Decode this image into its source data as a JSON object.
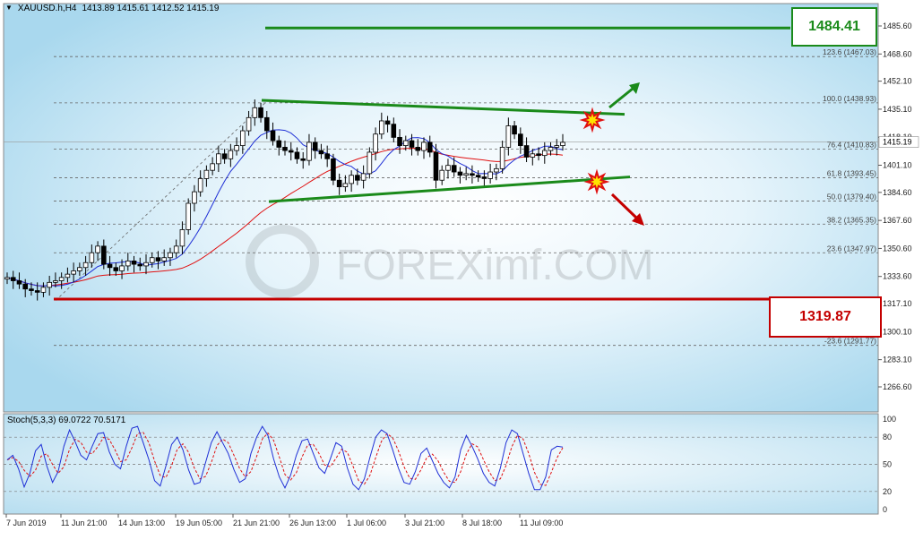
{
  "header": {
    "symbol": "XAUUSD.h,H4",
    "ohlc": "1413.89 1415.61 1412.52 1415.19"
  },
  "watermark": "FOREXimf.COM",
  "resistance_label": "1484.41",
  "support_label": "1319.87",
  "stoch_header": "Stoch(5,3,3) 69.0722 70.5171",
  "colors": {
    "resistance": "#1a8a1a",
    "support": "#c40000",
    "candle_up": "#000000",
    "ma_fast": "#1f2fd6",
    "ma_slow": "#e01010",
    "stoch_main": "#1f2fd6",
    "stoch_signal": "#e01010"
  },
  "chart_data": {
    "type": "candlestick",
    "instrument": "XAUUSD.h",
    "timeframe": "H4",
    "last_price": 1415.19,
    "price_ticks": [
      "1485.60",
      "1468.60",
      "1452.10",
      "1435.10",
      "1418.10",
      "1401.10",
      "1384.60",
      "1367.60",
      "1350.60",
      "1333.60",
      "1317.10",
      "1300.10",
      "1283.10",
      "1266.60"
    ],
    "price_tick_values": [
      1485.6,
      1468.6,
      1452.1,
      1435.1,
      1418.1,
      1401.1,
      1384.6,
      1367.6,
      1350.6,
      1333.6,
      1317.1,
      1300.1,
      1283.1,
      1266.6
    ],
    "time_ticks": [
      "7 Jun 2019",
      "11 Jun 21:00",
      "14 Jun 13:00",
      "19 Jun 05:00",
      "21 Jun 21:00",
      "26 Jun 13:00",
      "1 Jul 06:00",
      "3 Jul 21:00",
      "8 Jul 18:00",
      "11 Jul 09:00"
    ],
    "fib_levels": [
      {
        "label": "123.6 (1467.03)",
        "value": 1467.03
      },
      {
        "label": "100.0 (1438.93)",
        "value": 1438.93
      },
      {
        "label": "76.4 (1410.83)",
        "value": 1410.83
      },
      {
        "label": "61.8 (1393.45)",
        "value": 1393.45
      },
      {
        "label": "50.0 (1379.40)",
        "value": 1379.4
      },
      {
        "label": "38.2 (1365.35)",
        "value": 1365.35
      },
      {
        "label": "23.6 (1347.97)",
        "value": 1347.97
      },
      {
        "label": "-23.6 (1291.77)",
        "value": 1291.77
      }
    ],
    "resistance": 1484.41,
    "support": 1319.87,
    "triangle_upper": {
      "start_price": 1440.5,
      "end_price": 1432.0
    },
    "triangle_lower": {
      "start_price": 1379.0,
      "end_price": 1394.0
    },
    "closes": [
      1333,
      1331,
      1329,
      1326,
      1325,
      1324,
      1327,
      1330,
      1331,
      1333,
      1335,
      1337,
      1339,
      1342,
      1348,
      1352,
      1341,
      1339,
      1337,
      1340,
      1343,
      1341,
      1340,
      1342,
      1345,
      1343,
      1345,
      1348,
      1352,
      1362,
      1378,
      1385,
      1393,
      1398,
      1402,
      1408,
      1405,
      1410,
      1413,
      1422,
      1430,
      1436,
      1430,
      1422,
      1416,
      1412,
      1410,
      1409,
      1405,
      1404,
      1415,
      1410,
      1408,
      1405,
      1392,
      1388,
      1390,
      1395,
      1392,
      1396,
      1409,
      1420,
      1428,
      1426,
      1418,
      1413,
      1416,
      1412,
      1410,
      1415,
      1409,
      1392,
      1398,
      1401,
      1397,
      1395,
      1396,
      1395,
      1394,
      1393,
      1397,
      1399,
      1412,
      1425,
      1420,
      1413,
      1406,
      1408,
      1407,
      1410,
      1412,
      1413,
      1415
    ],
    "stoch_levels": [
      100,
      80,
      50,
      20,
      0
    ],
    "stoch_values": [
      55,
      60,
      45,
      25,
      40,
      65,
      72,
      48,
      30,
      42,
      70,
      88,
      75,
      60,
      55,
      70,
      84,
      85,
      64,
      50,
      45,
      70,
      90,
      92,
      74,
      55,
      32,
      26,
      48,
      72,
      80,
      66,
      44,
      28,
      30,
      52,
      74,
      86,
      74,
      62,
      44,
      30,
      34,
      62,
      80,
      92,
      82,
      56,
      36,
      24,
      38,
      60,
      76,
      78,
      62,
      46,
      40,
      56,
      74,
      70,
      46,
      28,
      22,
      34,
      58,
      80,
      88,
      84,
      66,
      46,
      30,
      28,
      42,
      62,
      68,
      54,
      40,
      30,
      24,
      36,
      66,
      82,
      70,
      56,
      40,
      30,
      26,
      46,
      74,
      88,
      84,
      62,
      40,
      22,
      22,
      36,
      66,
      70,
      69
    ]
  }
}
